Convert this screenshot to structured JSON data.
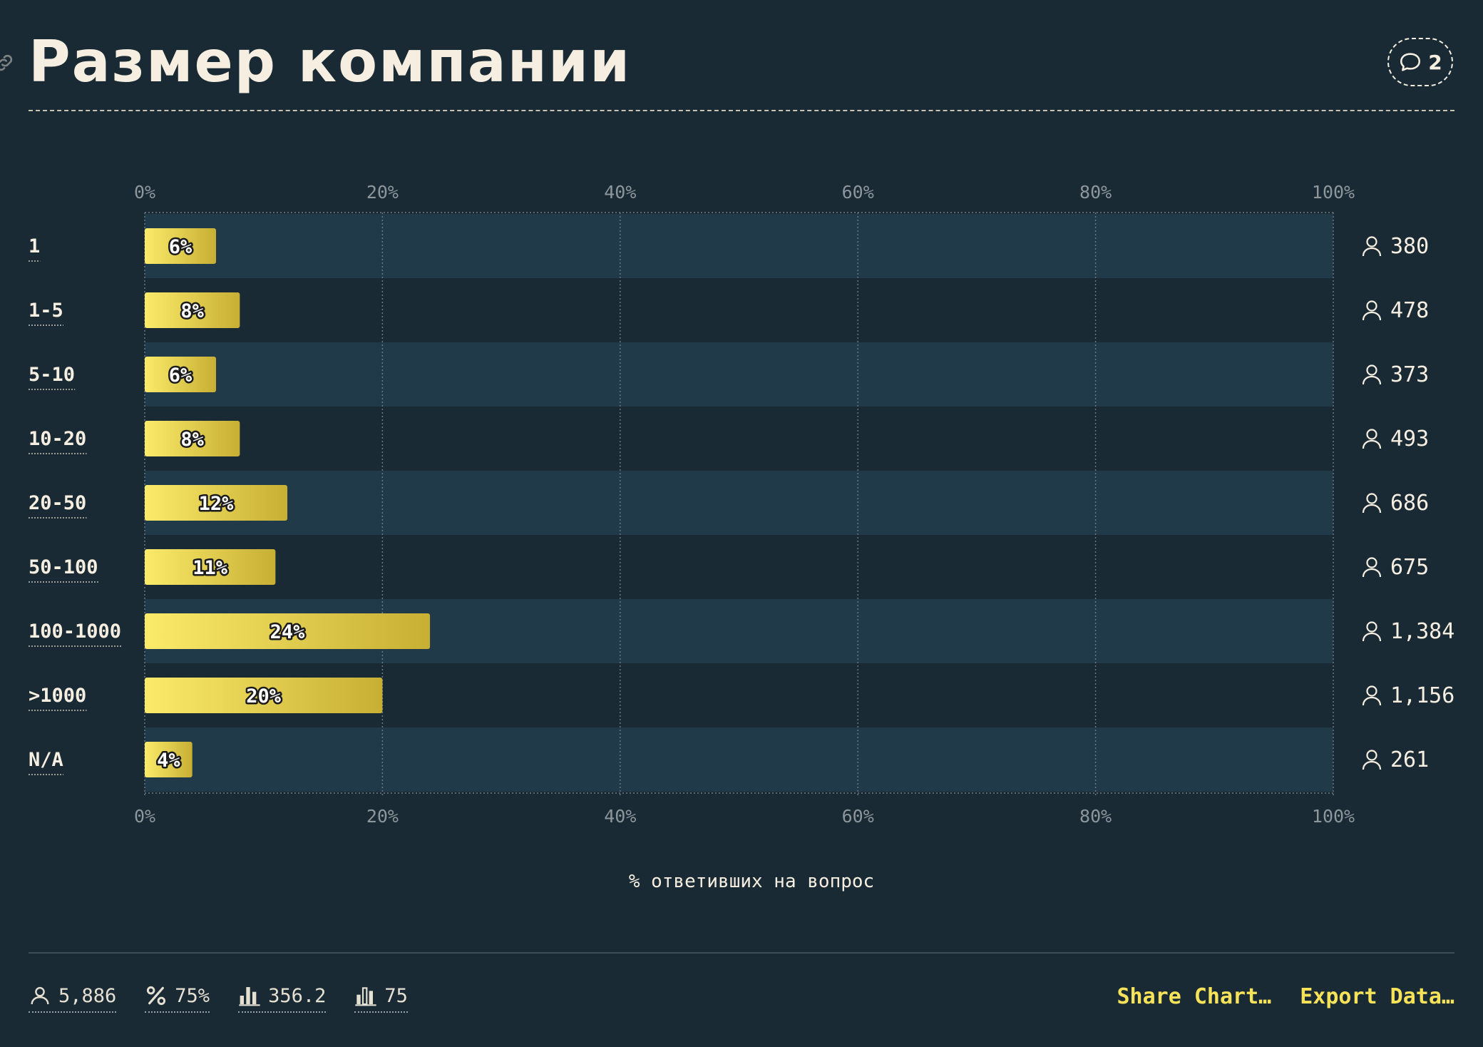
{
  "title": "Размер компании",
  "comments": {
    "count": "2"
  },
  "colors": {
    "background": "#192a34",
    "band": "#203a4a",
    "bar_start": "#fbeb6a",
    "bar_end": "#c7af34",
    "accent": "#f6e35a",
    "text": "#f6efe1",
    "axis": "#8d969b"
  },
  "chart_data": {
    "type": "bar",
    "orientation": "horizontal",
    "categories": [
      "1",
      "1-5",
      "5-10",
      "10-20",
      "20-50",
      "50-100",
      "100-1000",
      ">1000",
      "N/A"
    ],
    "values": [
      6,
      8,
      6,
      8,
      12,
      11,
      24,
      20,
      4
    ],
    "value_labels": [
      "6%",
      "8%",
      "6%",
      "8%",
      "12%",
      "11%",
      "24%",
      "20%",
      "4%"
    ],
    "counts": [
      "380",
      "478",
      "373",
      "493",
      "686",
      "675",
      "1,384",
      "1,156",
      "261"
    ],
    "xlim": [
      0,
      100
    ],
    "xticks": [
      "0%",
      "20%",
      "40%",
      "60%",
      "80%",
      "100%"
    ],
    "xlabel": "% ответивших на вопрос",
    "grid": true
  },
  "footer": {
    "stats": [
      {
        "icon": "person-icon",
        "value": "5,886"
      },
      {
        "icon": "percent-icon",
        "value": "75%"
      },
      {
        "icon": "bar-chart-icon",
        "value": "356.2"
      },
      {
        "icon": "bar-chart-outline-icon",
        "value": "75"
      }
    ],
    "share_label": "Share Chart…",
    "export_label": "Export Data…"
  }
}
